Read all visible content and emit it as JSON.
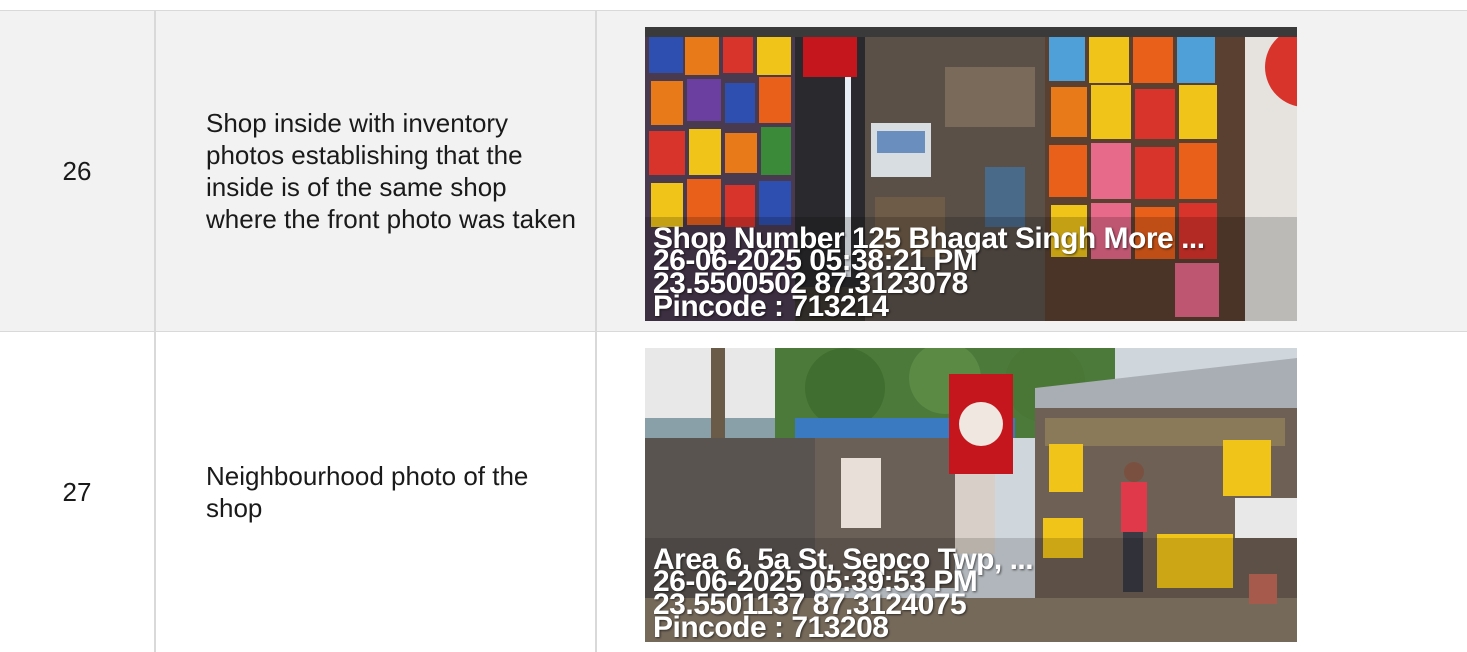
{
  "rows": [
    {
      "number": "26",
      "description": "Shop inside with inventory photos establishing that the inside is of the same shop where the front photo was taken",
      "photo": {
        "lines": [
          "Shop Number 125 Bhagat Singh More ...",
          "26-06-2025 05:38:21 PM",
          "23.5500502 87.3123078",
          "Pincode : 713214"
        ]
      }
    },
    {
      "number": "27",
      "description": "Neighbourhood photo of the shop",
      "photo": {
        "lines": [
          "Area 6, 5a St, Sepco Twp, ...",
          "26-06-2025 05:39:53 PM",
          "23.5501137 87.3124075",
          "Pincode : 713208"
        ]
      }
    }
  ]
}
